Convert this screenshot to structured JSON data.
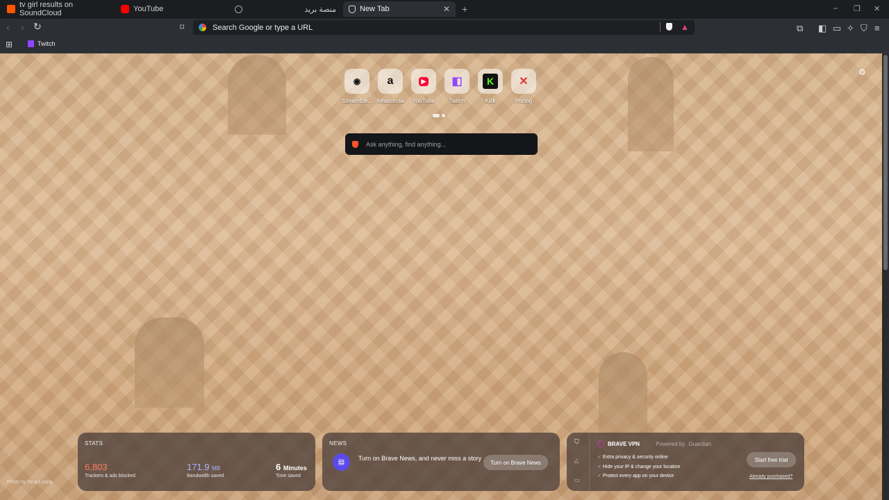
{
  "tabs": [
    {
      "title": "tv girl results on SoundCloud",
      "icon": "soundcloud-icon",
      "color": "#ff5500"
    },
    {
      "title": "YouTube",
      "icon": "youtube-icon",
      "color": "#ff0000"
    },
    {
      "title": "منصة بريد",
      "icon": "globe-icon"
    },
    {
      "title": "New Tab",
      "icon": "brave-shield-icon",
      "active": true
    }
  ],
  "address": {
    "placeholder": "Search Google or type a URL"
  },
  "bookmarks": [
    {
      "label": "Twitch",
      "icon": "twitch-icon",
      "color": "#9146ff"
    }
  ],
  "top_sites": [
    {
      "label": "StreamEle...",
      "glyph": "◉",
      "color": "#111111"
    },
    {
      "label": "Amazon.sa",
      "glyph": "a",
      "color": "#111111"
    },
    {
      "label": "YouTube",
      "glyph": "▶",
      "color": "#ff0033"
    },
    {
      "label": "Twitch",
      "glyph": "◧",
      "color": "#9146ff"
    },
    {
      "label": "Kick",
      "glyph": "K",
      "color": "#53fc18"
    },
    {
      "label": "Pricing",
      "glyph": "✕",
      "color": "#e0322f"
    }
  ],
  "search": {
    "placeholder": "Ask anything, find anything..."
  },
  "stats": {
    "title": "STATS",
    "trackers_value": "6,803",
    "trackers_label": "Trackers & ads blocked",
    "trackers_color": "#ff7a59",
    "bandwidth_value": "171.9",
    "bandwidth_unit": "MB",
    "bandwidth_label": "Bandwidth saved",
    "bandwidth_color": "#a8b6ff",
    "time_value": "6",
    "time_unit": "Minutes",
    "time_label": "Time saved"
  },
  "news": {
    "title": "NEWS",
    "text": "Turn on Brave News, and never miss a story",
    "button": "Turn on Brave News"
  },
  "vpn": {
    "title": "BRAVE VPN",
    "powered": "Powered by",
    "powered_brand": "Guardian",
    "features": [
      "Extra privacy & security online",
      "Hide your IP & change your location",
      "Protect every app on your device"
    ],
    "button": "Start free trial",
    "link": "Already purchased?"
  },
  "photo_credit": "Photo by Nina Luong"
}
